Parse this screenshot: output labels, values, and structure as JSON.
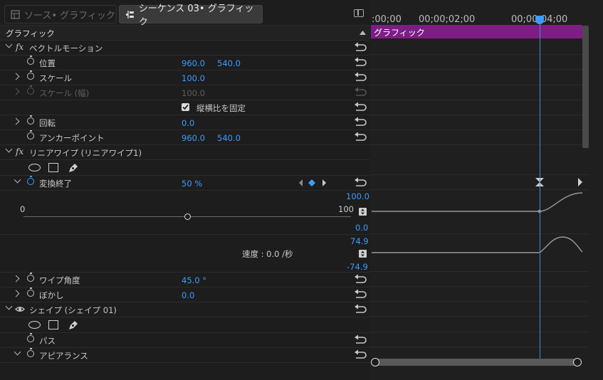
{
  "tabs": [
    {
      "label": "ソース• グラフィック",
      "active": false
    },
    {
      "label": "シーケンス 03• グラフィック",
      "active": true
    }
  ],
  "section_title": "グラフィック",
  "vector_motion": {
    "title": "ベクトルモーション",
    "position": {
      "label": "位置",
      "x": "960.0",
      "y": "540.0"
    },
    "scale": {
      "label": "スケール",
      "value": "100.0"
    },
    "scale_width": {
      "label": "スケール (幅)",
      "value": "100.0"
    },
    "uniform_scale": {
      "label": "縦横比を固定",
      "checked": true
    },
    "rotation": {
      "label": "回転",
      "value": "0.0"
    },
    "anchor": {
      "label": "アンカーポイント",
      "x": "960.0",
      "y": "540.0"
    }
  },
  "linear_wipe": {
    "title": "リニアワイプ (リニアワイプ1)",
    "transition": {
      "label": "変換終了",
      "value": "50 %"
    },
    "slider": {
      "min": "0",
      "max": "100",
      "level": 0.5
    },
    "graph_value": {
      "top": "100.0",
      "bottom": "0.0"
    },
    "graph_velocity": {
      "top": "74.9",
      "bottom": "-74.9",
      "speed_text": "速度 : 0.0 /秒"
    },
    "wipe_angle": {
      "label": "ワイプ角度",
      "value": "45.0 °"
    },
    "feather": {
      "label": "ぼかし",
      "value": "0.0"
    }
  },
  "shape": {
    "title": "シェイプ (シェイプ 01)",
    "path": {
      "label": "パス"
    },
    "appearance": {
      "label": "アピアランス"
    }
  },
  "timeline": {
    "ruler": [
      ":00;00",
      "00;00;02;00",
      "00;00;04;00"
    ],
    "clip_label": "グラフィック"
  },
  "colors": {
    "accent": "#3d9cff",
    "clip": "#7e1e85",
    "background": "#1d1d1d"
  },
  "icons": [
    "stopwatch-icon",
    "reset-icon",
    "ellipse-mask-icon",
    "rectangle-mask-icon",
    "pen-mask-icon",
    "keyframe-icon",
    "panel-menu-icon",
    "eye-icon",
    "fx-icon"
  ]
}
